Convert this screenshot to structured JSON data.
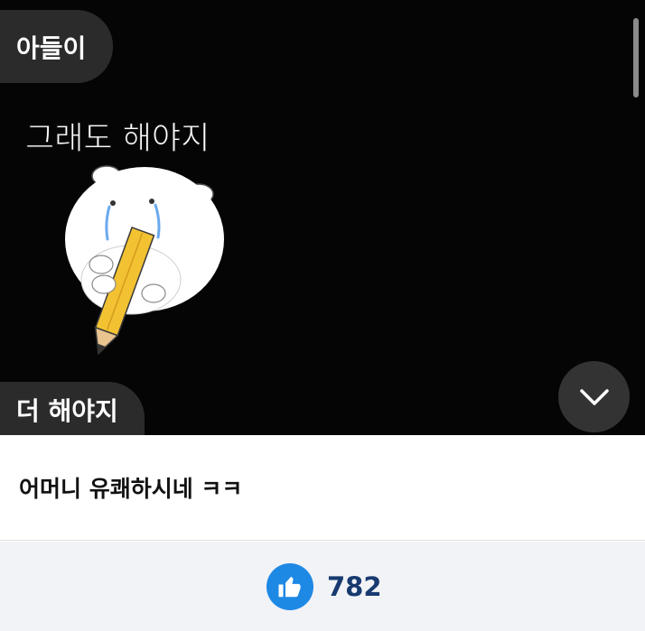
{
  "chat": {
    "bubble_top": "아들이",
    "sticker_text": "그래도 해야지",
    "bubble_bottom": "더 해야지"
  },
  "caption": "어머니 유쾌하시네 ㅋㅋ",
  "likes": {
    "count": "782"
  },
  "icons": {
    "scroll_down": "chevron-down-icon",
    "like": "thumbs-up-icon"
  },
  "colors": {
    "chat_background": "#050505",
    "bubble": "#2b2b2b",
    "like_button": "#1e88e5",
    "like_count": "#173a70"
  }
}
